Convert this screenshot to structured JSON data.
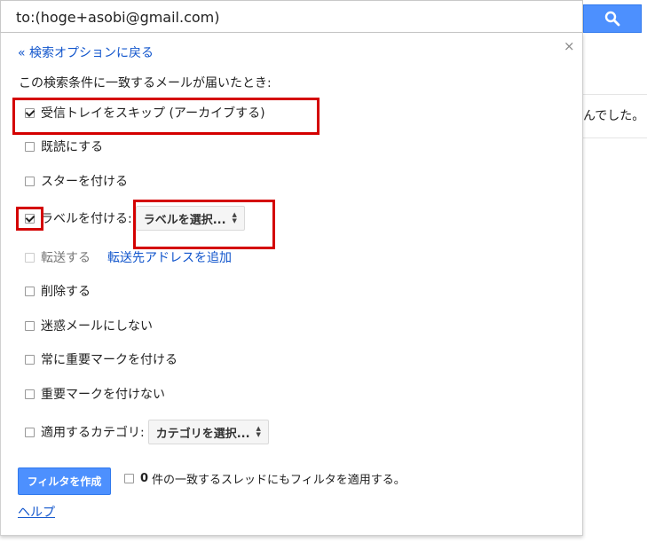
{
  "search": {
    "query": "to:(hoge+asobi@gmail.com)",
    "button_icon": "search-icon"
  },
  "background": {
    "snippet": "んでした。"
  },
  "panel": {
    "back_link": "« 検索オプションに戻る",
    "close": "×",
    "intro": "この検索条件に一致するメールが届いたとき:",
    "options": {
      "skip_inbox": {
        "label": "受信トレイをスキップ (アーカイブする)",
        "checked": true
      },
      "mark_read": {
        "label": "既読にする",
        "checked": false
      },
      "star": {
        "label": "スターを付ける",
        "checked": false
      },
      "apply_label": {
        "label": "ラベルを付ける:",
        "checked": true,
        "select": "ラベルを選択..."
      },
      "forward": {
        "label": "転送する",
        "checked": false,
        "disabled": true,
        "link": "転送先アドレスを追加"
      },
      "delete": {
        "label": "削除する",
        "checked": false
      },
      "never_spam": {
        "label": "迷惑メールにしない",
        "checked": false
      },
      "always_important": {
        "label": "常に重要マークを付ける",
        "checked": false
      },
      "never_important": {
        "label": "重要マークを付けない",
        "checked": false
      },
      "category": {
        "label": "適用するカテゴリ:",
        "checked": false,
        "select": "カテゴリを選択..."
      }
    },
    "create_button": "フィルタを作成",
    "apply_existing": {
      "count": "0",
      "text": "件の一致するスレッドにもフィルタを適用する。",
      "checked": false
    },
    "help": "ヘルプ"
  },
  "colors": {
    "accent": "#4d90fe",
    "link": "#1155cc",
    "highlight": "#d40000"
  }
}
